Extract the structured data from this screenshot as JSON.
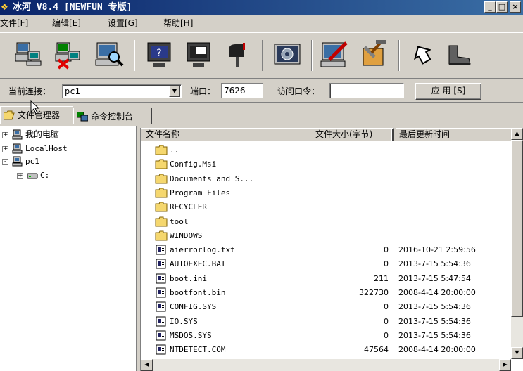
{
  "window": {
    "title": "冰河 V8.4 [NEWFUN 专版]",
    "controls": {
      "minimize": "_",
      "maximize": "□",
      "close": "×"
    }
  },
  "menu": [
    {
      "label": "文件[F]"
    },
    {
      "label": "编辑[E]"
    },
    {
      "label": "设置[G]"
    },
    {
      "label": "帮助[H]"
    }
  ],
  "toolbar": [
    {
      "icon": "add-computer-icon"
    },
    {
      "icon": "delete-computer-icon"
    },
    {
      "icon": "search-computer-icon"
    },
    {
      "icon": "screen-capture-icon"
    },
    {
      "icon": "screen-control-icon"
    },
    {
      "icon": "mailbox-icon"
    },
    {
      "icon": "settings-icon"
    },
    {
      "icon": "configure-server-icon"
    },
    {
      "icon": "tools-icon"
    },
    {
      "icon": "upgrade-icon"
    },
    {
      "icon": "exit-icon"
    }
  ],
  "connection": {
    "current_label": "当前连接：",
    "current_value": "pc1",
    "port_label": "端口：",
    "port_value": "7626",
    "password_label": "访问口令：",
    "password_value": "",
    "apply_label": "应 用 [S]"
  },
  "tabs": [
    {
      "label": "文件管理器",
      "active": true
    },
    {
      "label": "命令控制台",
      "active": false
    }
  ],
  "tree": [
    {
      "label": "我的电脑",
      "expander": "+"
    },
    {
      "label": "LocalHost",
      "expander": "+"
    },
    {
      "label": "pc1",
      "expander": "-"
    },
    {
      "label": "C:",
      "expander": "+"
    }
  ],
  "list": {
    "columns": {
      "name": "文件名称",
      "size": "文件大小(字节)",
      "time": "最后更新时间"
    },
    "rows": [
      {
        "name": "..",
        "type": "folder",
        "size": "",
        "time": ""
      },
      {
        "name": "Config.Msi",
        "type": "folder",
        "size": "",
        "time": ""
      },
      {
        "name": "Documents and S...",
        "type": "folder",
        "size": "",
        "time": ""
      },
      {
        "name": "Program Files",
        "type": "folder",
        "size": "",
        "time": ""
      },
      {
        "name": "RECYCLER",
        "type": "folder",
        "size": "",
        "time": ""
      },
      {
        "name": "tool",
        "type": "folder",
        "size": "",
        "time": ""
      },
      {
        "name": "WINDOWS",
        "type": "folder",
        "size": "",
        "time": ""
      },
      {
        "name": "aierrorlog.txt",
        "type": "file",
        "size": "0",
        "time": "2016-10-21 2:59:56"
      },
      {
        "name": "AUTOEXEC.BAT",
        "type": "file",
        "size": "0",
        "time": "2013-7-15 5:54:36"
      },
      {
        "name": "boot.ini",
        "type": "file",
        "size": "211",
        "time": "2013-7-15 5:47:54"
      },
      {
        "name": "bootfont.bin",
        "type": "file",
        "size": "322730",
        "time": "2008-4-14 20:00:00"
      },
      {
        "name": "CONFIG.SYS",
        "type": "file",
        "size": "0",
        "time": "2013-7-15 5:54:36"
      },
      {
        "name": "IO.SYS",
        "type": "file",
        "size": "0",
        "time": "2013-7-15 5:54:36"
      },
      {
        "name": "MSDOS.SYS",
        "type": "file",
        "size": "0",
        "time": "2013-7-15 5:54:36"
      },
      {
        "name": "NTDETECT.COM",
        "type": "file",
        "size": "47564",
        "time": "2008-4-14 20:00:00"
      }
    ]
  },
  "colors": {
    "title_bar": "#0a246a",
    "face": "#d4d0c8",
    "folder": "#f5d76e"
  }
}
